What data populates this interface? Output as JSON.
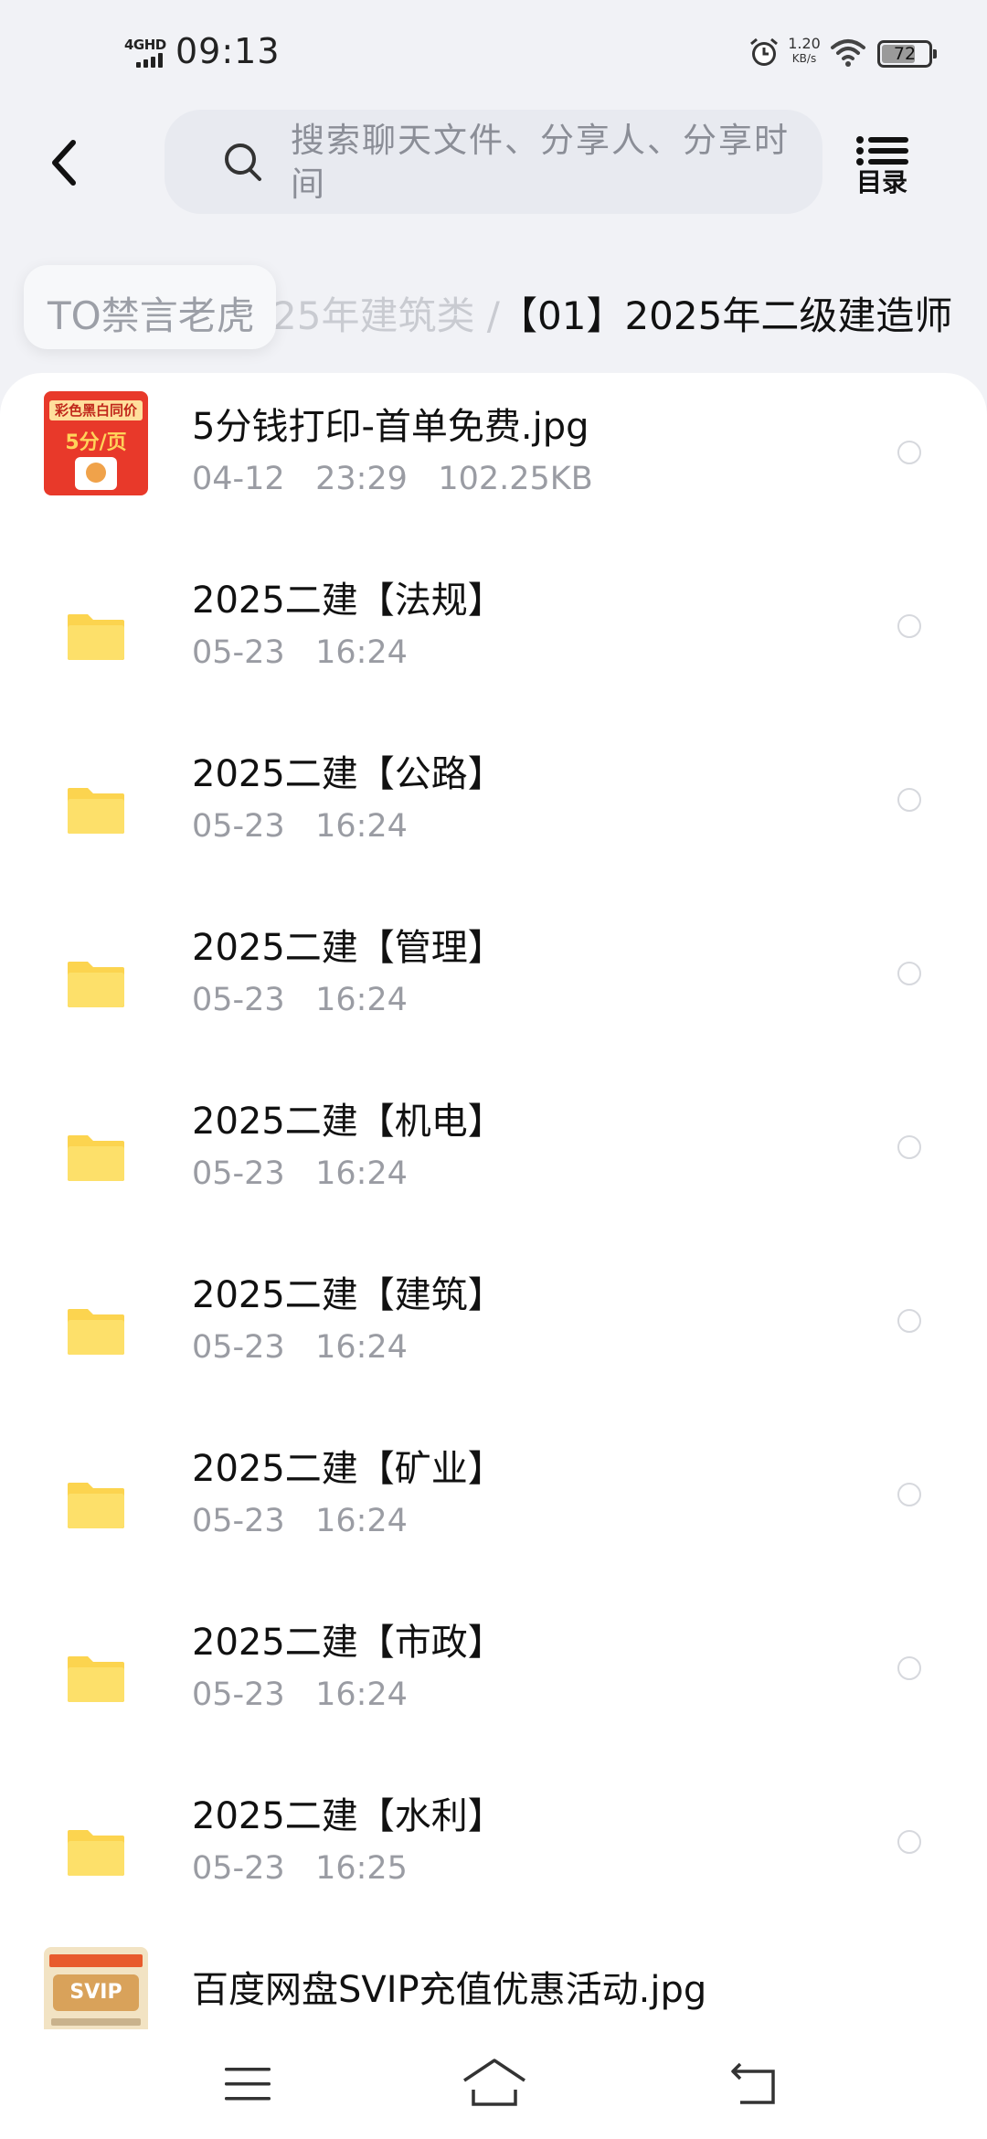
{
  "status_bar": {
    "network": "4GHD",
    "time": "09:13",
    "speed_value": "1.20",
    "speed_unit": "KB/s",
    "battery_level": "72",
    "battery_fraction": 0.72
  },
  "header": {
    "search_placeholder": "搜索聊天文件、分享人、分享时间",
    "toc_label": "目录"
  },
  "breadcrumb": {
    "chip": "TO禁言老虎",
    "previous": "25年建筑类  /",
    "current": "【01】2025年二级建造师"
  },
  "files": [
    {
      "type": "image",
      "thumb": "print",
      "name": "5分钱打印-首单免费.jpg",
      "meta": "04-12   23:29   102.25KB",
      "thumb_text_top": "彩色黑白同价",
      "thumb_text_main": "5分/页"
    },
    {
      "type": "folder",
      "name": "2025二建【法规】",
      "meta": "05-23   16:24"
    },
    {
      "type": "folder",
      "name": "2025二建【公路】",
      "meta": "05-23   16:24"
    },
    {
      "type": "folder",
      "name": "2025二建【管理】",
      "meta": "05-23   16:24"
    },
    {
      "type": "folder",
      "name": "2025二建【机电】",
      "meta": "05-23   16:24"
    },
    {
      "type": "folder",
      "name": "2025二建【建筑】",
      "meta": "05-23   16:24"
    },
    {
      "type": "folder",
      "name": "2025二建【矿业】",
      "meta": "05-23   16:24"
    },
    {
      "type": "folder",
      "name": "2025二建【市政】",
      "meta": "05-23   16:24"
    },
    {
      "type": "folder",
      "name": "2025二建【水利】",
      "meta": "05-23   16:25"
    },
    {
      "type": "image",
      "thumb": "svip",
      "name": "百度网盘SVIP充值优惠活动.jpg",
      "meta": "",
      "thumb_text_main": "SVIP"
    }
  ],
  "colors": {
    "folder": "#fcd44f",
    "background": "#f1f2f6",
    "text_secondary": "#9a9ca3"
  },
  "icons": {
    "back": "chevron-left-icon",
    "search": "search-icon",
    "toc": "list-icon",
    "folder": "folder-icon",
    "nav_menu": "menu-icon",
    "nav_home": "home-icon",
    "nav_back": "back-icon"
  }
}
